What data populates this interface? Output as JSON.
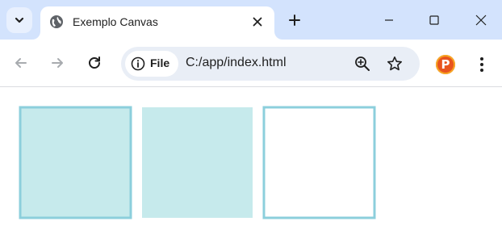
{
  "browser": {
    "tab": {
      "title": "Exemplo Canvas"
    },
    "address_bar": {
      "site_chip_label": "File",
      "url": "C:/app/index.html"
    },
    "profile": {
      "initial": "P"
    },
    "icons": {
      "tab_search": "chevron-down-icon",
      "favicon": "globe-icon",
      "tab_close": "close-icon",
      "new_tab": "plus-icon",
      "minimize": "minimize-icon",
      "maximize": "maximize-icon",
      "close_window": "close-icon",
      "back": "back-arrow-icon",
      "forward": "forward-arrow-icon",
      "reload": "reload-icon",
      "site_info": "info-icon",
      "zoom": "zoom-in-icon",
      "bookmark": "star-icon",
      "menu": "kebab-menu-icon"
    },
    "colors": {
      "tabstrip": "#d3e3fd",
      "omnibox": "#e9eef6",
      "avatar": "#e8541e"
    }
  },
  "canvas": {
    "shapes": [
      {
        "kind": "filled-stroked-rect",
        "fill": "#c6eaec",
        "stroke": "#8ccfdc"
      },
      {
        "kind": "filled-rect",
        "fill": "#c6eaec"
      },
      {
        "kind": "stroked-rect",
        "stroke": "#8ccfdc"
      }
    ]
  }
}
